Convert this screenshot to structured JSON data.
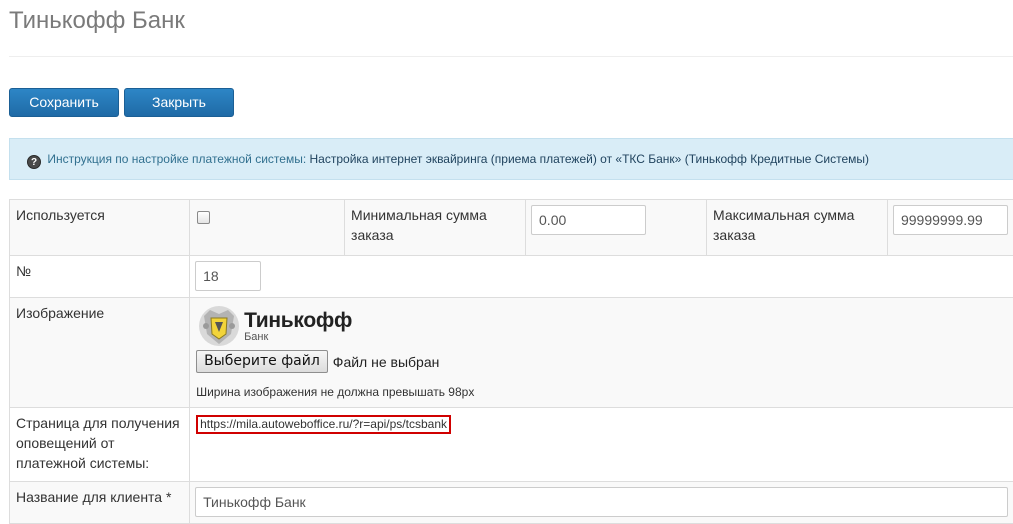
{
  "page": {
    "title": "Тинькофф Банк"
  },
  "toolbar": {
    "save_label": "Сохранить",
    "close_label": "Закрыть"
  },
  "alert": {
    "icon": "help-icon",
    "icon_glyph": "?",
    "prefix": "Инструкция по настройке платежной системы:",
    "link": "Настройка интернет эквайринга (приема платежей) от «ТКС Банк» (Тинькофф Кредитные Системы)"
  },
  "form": {
    "used_label": "Используется",
    "used_checked": false,
    "min_label": "Минимальная сумма заказа",
    "min_value": "0.00",
    "max_label": "Максимальная сумма заказа",
    "max_value": "99999999.99",
    "number_label": "№",
    "number_value": "18",
    "image_label": "Изображение",
    "logo_brand": "Тинькофф",
    "logo_sub": "Банк",
    "file_button": "Выберите файл",
    "file_status": "Файл не выбран",
    "image_hint": "Ширина изображения не должна превышать 98px",
    "notify_label": "Страница для получения оповещений от платежной системы:",
    "notify_url": "https://mila.autoweboffice.ru/?r=api/ps/tcsbank",
    "client_name_label": "Название для клиента *",
    "client_name_value": "Тинькофф Банк"
  },
  "colors": {
    "primary_button": "#2a7fc0",
    "alert_bg": "#d9edf7",
    "highlight_border": "#d00000"
  }
}
